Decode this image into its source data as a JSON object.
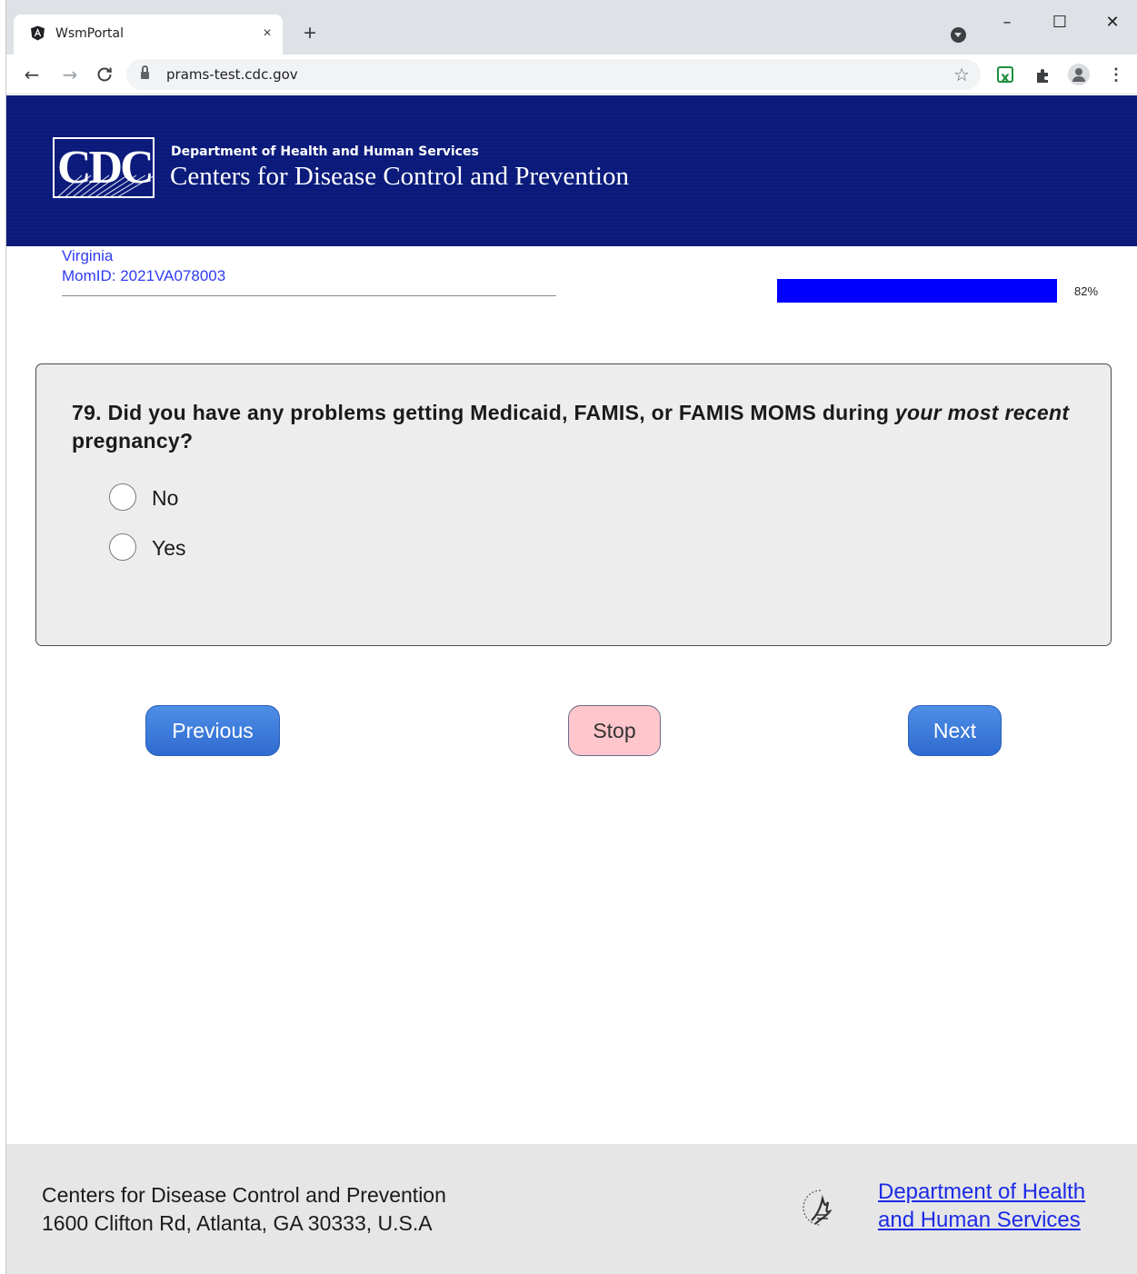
{
  "browser": {
    "tab_title": "WsmPortal",
    "tab_close": "×",
    "new_tab": "+",
    "url": "prams-test.cdc.gov",
    "window_min": "–",
    "window_max": "☐",
    "window_close": "✕",
    "back": "←",
    "forward": "→",
    "reload": "C",
    "star": "☆",
    "ext_green": "x",
    "ext_puzzle": "✱",
    "menu": "⋮"
  },
  "header": {
    "logo_text": "CDC",
    "department": "Department of Health and Human Services",
    "agency": "Centers for Disease Control and Prevention"
  },
  "meta": {
    "state": "Virginia",
    "momid": "MomID: 2021VA078003",
    "progress_percent": 82,
    "progress_label": "82%"
  },
  "question": {
    "number": "79.",
    "text_part1": "Did you have any problems getting Medicaid, FAMIS, or FAMIS MOMS during ",
    "text_italic1": "your most recent",
    "text_part2": " pregnancy?",
    "options": [
      {
        "label": "No"
      },
      {
        "label": "Yes"
      }
    ]
  },
  "nav": {
    "previous": "Previous",
    "stop": "Stop",
    "next": "Next"
  },
  "footer": {
    "org": "Centers for Disease Control and Prevention",
    "address": "1600 Clifton Rd, Atlanta, GA 30333, U.S.A",
    "hhs_link_line1": "Department of Health",
    "hhs_link_line2": "and Human Services"
  },
  "colors": {
    "header_bg": "#0b1a78",
    "link_blue": "#2f3cf0",
    "progress_fill": "#0000ff",
    "button_blue": "#2f6bd0",
    "stop_pink": "#ffc6cc"
  },
  "icons": {
    "favicon": "angular-icon",
    "lock": "lock-icon",
    "hhs_logo": "hhs-eagle-icon"
  }
}
